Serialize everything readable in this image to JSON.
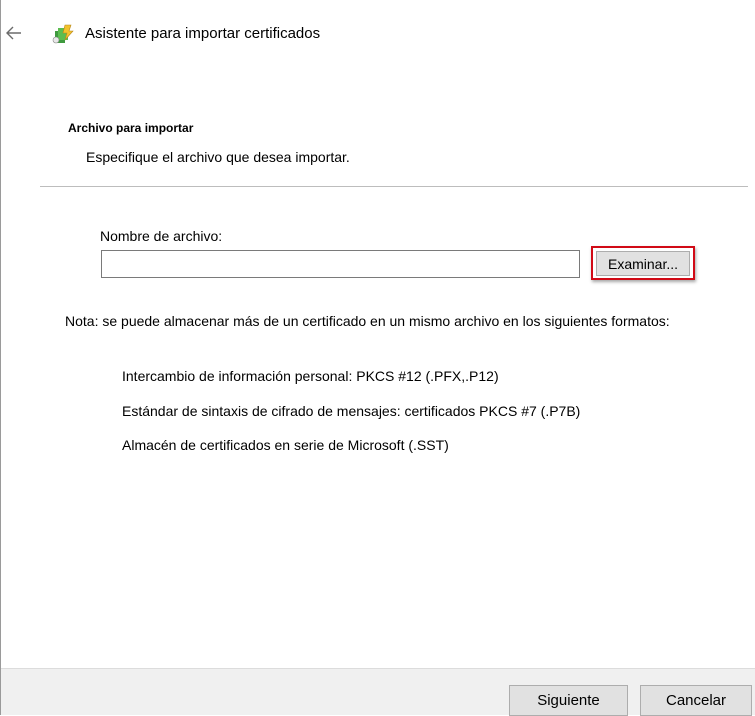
{
  "window": {
    "title": "Asistente para importar certificados",
    "back_icon": "back-arrow-icon",
    "app_icon": "certificate-wizard-icon"
  },
  "page": {
    "heading": "Archivo para importar",
    "description": "Especifique el archivo que desea importar."
  },
  "file": {
    "label": "Nombre de archivo:",
    "value": "",
    "browse_label": "Examinar..."
  },
  "note": {
    "text": "Nota: se puede almacenar más de un certificado en un mismo archivo en los siguientes formatos:",
    "formats": [
      "Intercambio de información personal: PKCS #12 (.PFX,.P12)",
      "Estándar de sintaxis de cifrado de mensajes: certificados PKCS #7 (.P7B)",
      "Almacén de certificados en serie de Microsoft (.SST)"
    ]
  },
  "footer": {
    "next_label": "Siguiente",
    "cancel_label": "Cancelar"
  },
  "colors": {
    "highlight": "#d10a16",
    "footer_bg": "#f0f0f0",
    "button_bg": "#e1e1e1"
  }
}
